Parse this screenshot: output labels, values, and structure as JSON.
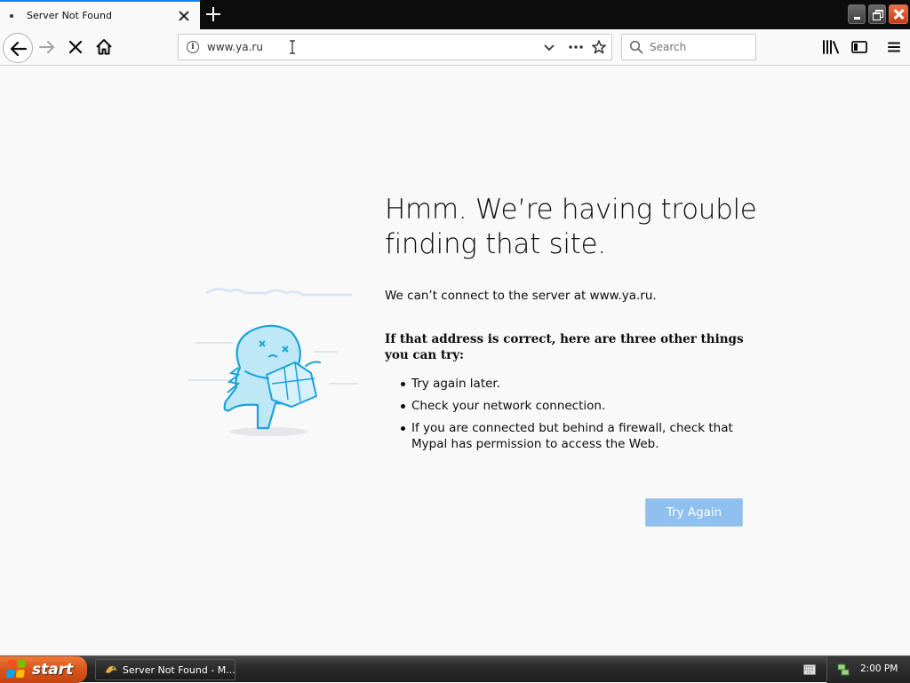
{
  "tab": {
    "title": "Server Not Found"
  },
  "navbar": {
    "url": "www.ya.ru",
    "search_placeholder": "Search"
  },
  "error": {
    "title": "Hmm. We’re having trouble finding that site.",
    "description": "We can’t connect to the server at www.ya.ru.",
    "subtitle": "If that address is correct, here are three other things you can try:",
    "suggestions": [
      "Try again later.",
      "Check your network connection.",
      "If you are connected but behind a firewall, check that Mypal has permission to access the Web."
    ],
    "button_label": "Try Again"
  },
  "taskbar": {
    "start_label": "start",
    "task_label": "Server Not Found - M...",
    "clock": "2:00 PM"
  },
  "colors": {
    "accent": "#0a84ff",
    "button": "#8fc0ef",
    "start": "#d9531a",
    "close": "#c23b18"
  }
}
